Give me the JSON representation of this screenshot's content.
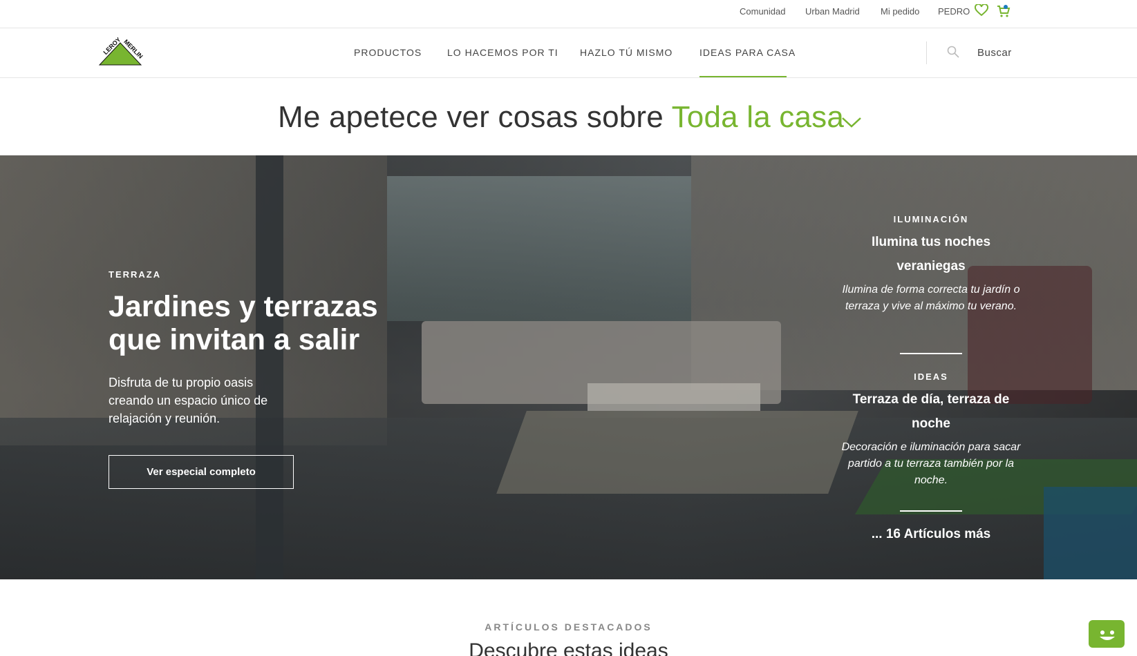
{
  "topbar": {
    "links": [
      "Comunidad",
      "Urban Madrid",
      "Mi pedido",
      "PEDRO"
    ],
    "wishlist_icon": "heart-icon",
    "cart_icon": "cart-icon"
  },
  "brand": {
    "logo_text": "LEROY MERLIN",
    "accent_color": "#78b530"
  },
  "nav": {
    "items": [
      "PRODUCTOS",
      "LO HACEMOS POR TI",
      "HAZLO TÚ MISMO",
      "IDEAS PARA CASA"
    ],
    "active": "IDEAS PARA CASA",
    "search_label": "Buscar"
  },
  "selector": {
    "prefix": "Me apetece ver cosas sobre",
    "value": "Toda la casa"
  },
  "hero": {
    "category": "TERRAZA",
    "title": "Jardines y terrazas que invitan a salir",
    "description": "Disfruta de tu propio oasis creando un espacio único de relajación y reunión.",
    "cta_label": "Ver especial completo",
    "side_articles": [
      {
        "category": "ILUMINACIÓN",
        "title": "Ilumina tus noches veraniegas",
        "description": "Ilumina de forma correcta tu jardín o terraza y vive al máximo tu verano."
      },
      {
        "category": "IDEAS",
        "title": "Terraza de día, terraza de noche",
        "description": "Decoración e iluminación para sacar partido a tu terraza también por la noche."
      }
    ],
    "more_label": "... 16 Artículos más"
  },
  "featured": {
    "label": "ARTÍCULOS DESTACADOS",
    "title": "Descubre estas ideas"
  }
}
